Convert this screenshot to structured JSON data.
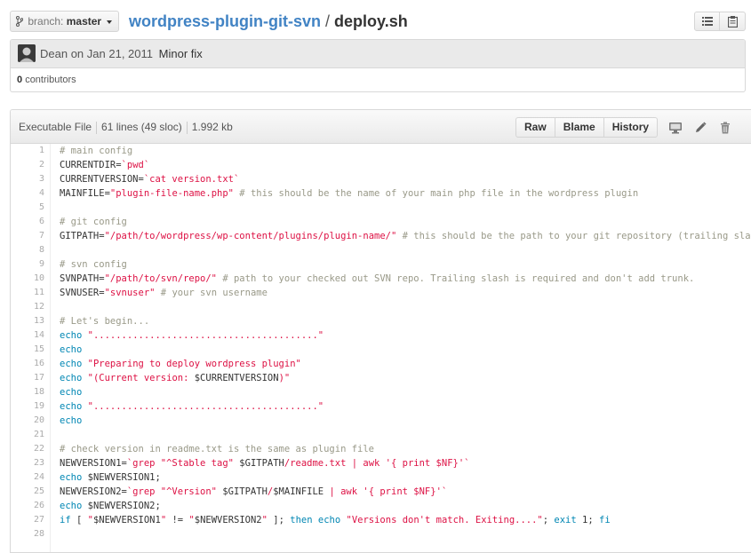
{
  "breadcrumb": {
    "branch_prefix": "branch:",
    "branch_name": "master",
    "repo": "wordpress-plugin-git-svn",
    "separator": "/",
    "file": "deploy.sh"
  },
  "commit": {
    "author": "Dean",
    "on": "on",
    "date": "Jan 21, 2011",
    "message": "Minor fix",
    "contributors_count": "0",
    "contributors_label": "contributors"
  },
  "file_info": {
    "mode": "Executable File",
    "lines": "61 lines (49 sloc)",
    "size": "1.992 kb",
    "buttons": [
      "Raw",
      "Blame",
      "History"
    ]
  },
  "icons": {
    "list": "list-icon",
    "clipboard": "clipboard-icon",
    "desktop": "desktop-icon",
    "edit": "pencil-icon",
    "delete": "trash-icon",
    "branch": "branch-icon"
  },
  "colors": {
    "link": "#4183c4",
    "comment": "#999988",
    "string": "#d14",
    "keyword": "#0086b3"
  },
  "code_lines": [
    {
      "n": "1",
      "t": [
        [
          "c",
          "# main config"
        ]
      ]
    },
    {
      "n": "2",
      "t": [
        [
          "p",
          "CURRENTDIR="
        ],
        [
          "s",
          "`pwd`"
        ]
      ]
    },
    {
      "n": "3",
      "t": [
        [
          "p",
          "CURRENTVERSION="
        ],
        [
          "s",
          "`cat version.txt`"
        ]
      ]
    },
    {
      "n": "4",
      "t": [
        [
          "p",
          "MAINFILE="
        ],
        [
          "s",
          "\"plugin-file-name.php\""
        ],
        [
          "c",
          " # this should be the name of your main php file in the wordpress plugin"
        ]
      ]
    },
    {
      "n": "5",
      "t": []
    },
    {
      "n": "6",
      "t": [
        [
          "c",
          "# git config"
        ]
      ]
    },
    {
      "n": "7",
      "t": [
        [
          "p",
          "GITPATH="
        ],
        [
          "s",
          "\"/path/to/wordpress/wp-content/plugins/plugin-name/\""
        ],
        [
          "c",
          " # this should be the path to your git repository (trailing slash requ"
        ]
      ]
    },
    {
      "n": "8",
      "t": []
    },
    {
      "n": "9",
      "t": [
        [
          "c",
          "# svn config"
        ]
      ]
    },
    {
      "n": "10",
      "t": [
        [
          "p",
          "SVNPATH="
        ],
        [
          "s",
          "\"/path/to/svn/repo/\""
        ],
        [
          "c",
          " # path to your checked out SVN repo. Trailing slash is required and don't add trunk."
        ]
      ]
    },
    {
      "n": "11",
      "t": [
        [
          "p",
          "SVNUSER="
        ],
        [
          "s",
          "\"svnuser\""
        ],
        [
          "c",
          " # your svn username"
        ]
      ]
    },
    {
      "n": "12",
      "t": []
    },
    {
      "n": "13",
      "t": [
        [
          "c",
          "# Let's begin..."
        ]
      ]
    },
    {
      "n": "14",
      "t": [
        [
          "k",
          "echo"
        ],
        [
          "s",
          " \"........................................\""
        ]
      ]
    },
    {
      "n": "15",
      "t": [
        [
          "k",
          "echo"
        ]
      ]
    },
    {
      "n": "16",
      "t": [
        [
          "k",
          "echo"
        ],
        [
          "s",
          " \"Preparing to deploy wordpress plugin\""
        ]
      ]
    },
    {
      "n": "17",
      "t": [
        [
          "k",
          "echo"
        ],
        [
          "s",
          " \"(Current version: "
        ],
        [
          "p",
          "$CURRENTVERSION"
        ],
        [
          "s",
          ")\""
        ]
      ]
    },
    {
      "n": "18",
      "t": [
        [
          "k",
          "echo"
        ]
      ]
    },
    {
      "n": "19",
      "t": [
        [
          "k",
          "echo"
        ],
        [
          "s",
          " \"........................................\""
        ]
      ]
    },
    {
      "n": "20",
      "t": [
        [
          "k",
          "echo"
        ]
      ]
    },
    {
      "n": "21",
      "t": []
    },
    {
      "n": "22",
      "t": [
        [
          "c",
          "# check version in readme.txt is the same as plugin file"
        ]
      ]
    },
    {
      "n": "23",
      "t": [
        [
          "p",
          "NEWVERSION1="
        ],
        [
          "s",
          "`grep \"^Stable tag\" "
        ],
        [
          "p",
          "$GITPATH"
        ],
        [
          "s",
          "/readme.txt | awk '{ print $NF}'`"
        ]
      ]
    },
    {
      "n": "24",
      "t": [
        [
          "k",
          "echo"
        ],
        [
          "p",
          " $NEWVERSION1;"
        ]
      ]
    },
    {
      "n": "25",
      "t": [
        [
          "p",
          "NEWVERSION2="
        ],
        [
          "s",
          "`grep \"^Version\" "
        ],
        [
          "p",
          "$GITPATH"
        ],
        [
          "s",
          "/"
        ],
        [
          "p",
          "$MAINFILE"
        ],
        [
          "s",
          " | awk '{ print $NF}'`"
        ]
      ]
    },
    {
      "n": "26",
      "t": [
        [
          "k",
          "echo"
        ],
        [
          "p",
          " $NEWVERSION2;"
        ]
      ]
    },
    {
      "n": "27",
      "t": [
        [
          "k",
          "if"
        ],
        [
          "p",
          " [ "
        ],
        [
          "s",
          "\""
        ],
        [
          "p",
          "$NEWVERSION1"
        ],
        [
          "s",
          "\""
        ],
        [
          "p",
          " != "
        ],
        [
          "s",
          "\""
        ],
        [
          "p",
          "$NEWVERSION2"
        ],
        [
          "s",
          "\""
        ],
        [
          "p",
          " ]; "
        ],
        [
          "k",
          "then"
        ],
        [
          "p",
          " "
        ],
        [
          "k",
          "echo"
        ],
        [
          "s",
          " \"Versions don't match. Exiting....\""
        ],
        [
          "p",
          "; "
        ],
        [
          "k",
          "exit"
        ],
        [
          "p",
          " 1; "
        ],
        [
          "k",
          "fi"
        ]
      ]
    },
    {
      "n": "28",
      "t": []
    }
  ]
}
